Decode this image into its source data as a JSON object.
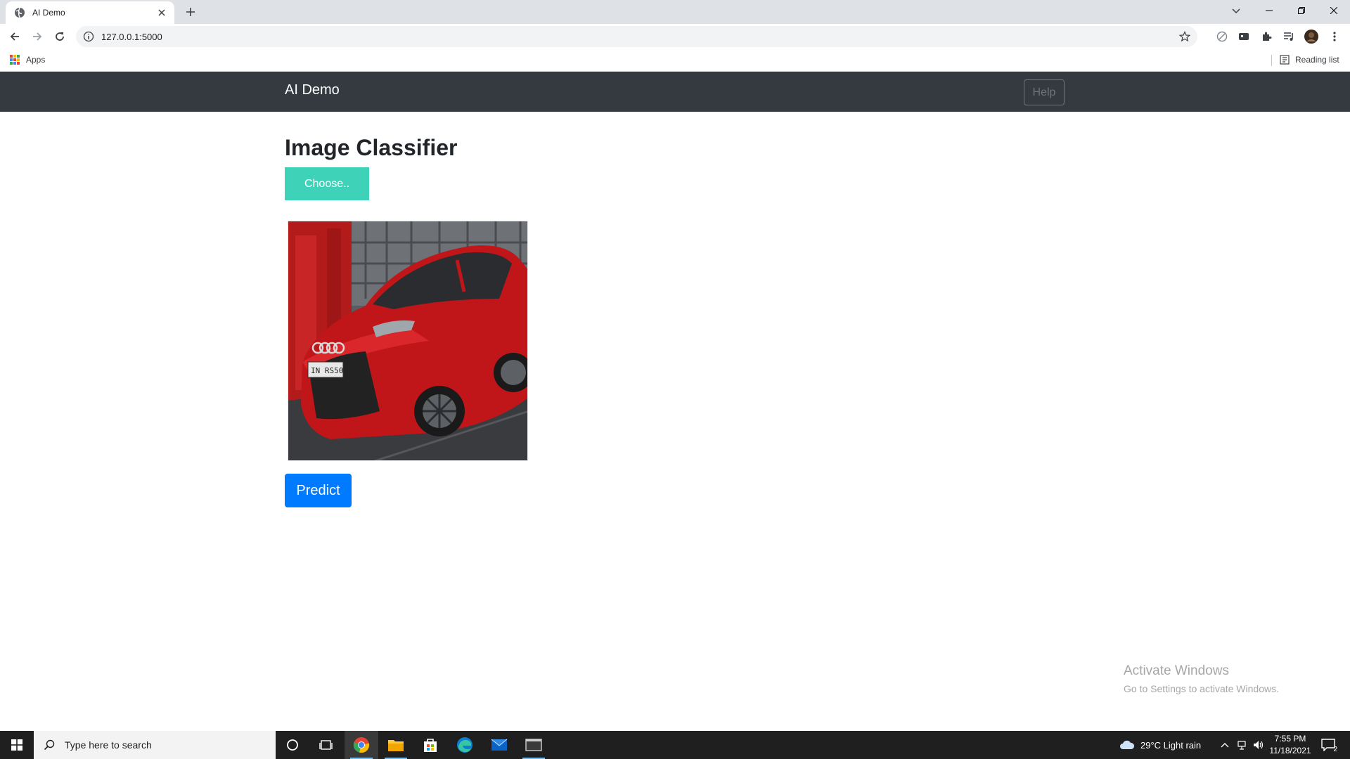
{
  "browser": {
    "tab_title": "AI Demo",
    "url": "127.0.0.1:5000",
    "bookmarks": {
      "apps_label": "Apps",
      "reading_list_label": "Reading list"
    }
  },
  "page": {
    "navbar": {
      "brand": "AI Demo",
      "help_label": "Help"
    },
    "title": "Image Classifier",
    "choose_label": "Choose..",
    "preview_alt": "Uploaded car image preview",
    "predict_label": "Predict"
  },
  "watermark": {
    "line1": "Activate Windows",
    "line2": "Go to Settings to activate Windows."
  },
  "taskbar": {
    "search_placeholder": "Type here to search",
    "weather": "29°C  Light rain",
    "time": "7:55 PM",
    "date": "11/18/2021",
    "notification_count": "2"
  },
  "colors": {
    "navbar_bg": "#343a40",
    "choose_bg": "#3ed3b9",
    "predict_bg": "#007bff",
    "taskbar_bg": "#1f1f1f"
  },
  "icons": [
    "globe-icon",
    "close-icon",
    "plus-icon",
    "back-icon",
    "forward-icon",
    "reload-icon",
    "info-icon",
    "star-icon",
    "apps-icon",
    "reading-list-icon",
    "windows-icon",
    "search-icon",
    "cortana-icon",
    "task-view-icon",
    "chrome-icon",
    "folder-icon",
    "store-icon",
    "edge-icon",
    "mail-icon",
    "terminal-icon",
    "cloud-icon"
  ]
}
